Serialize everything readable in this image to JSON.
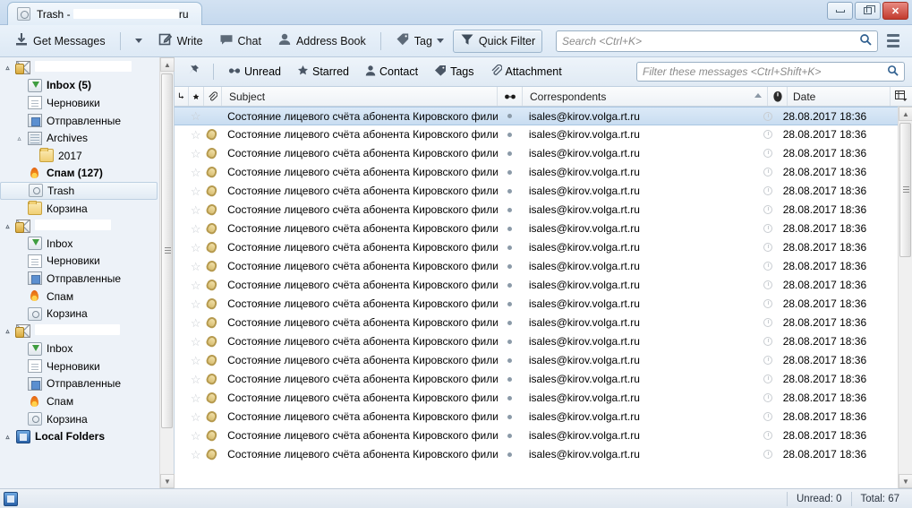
{
  "window": {
    "tab_title_prefix": "Trash - ",
    "tab_title_suffix": "ru",
    "tab_icon": "trash-icon",
    "minimize_label": "",
    "maximize_label": "",
    "close_label": "✕"
  },
  "toolbar": {
    "get_messages": "Get Messages",
    "write": "Write",
    "chat": "Chat",
    "address_book": "Address Book",
    "tag": "Tag",
    "quick_filter": "Quick Filter",
    "search_placeholder": "Search <Ctrl+K>"
  },
  "quick_filter_bar": {
    "unread": "Unread",
    "starred": "Starred",
    "contact": "Contact",
    "tags": "Tags",
    "attachment": "Attachment",
    "filter_placeholder": "Filter these messages <Ctrl+Shift+K>"
  },
  "columns": {
    "subject": "Subject",
    "correspondents": "Correspondents",
    "date": "Date"
  },
  "sidebar": {
    "items": [
      {
        "label": "",
        "redacted": true,
        "redact_width": 108,
        "icon": "account-icon",
        "indent": 0,
        "twisty": "▵",
        "bold": true,
        "selected": false
      },
      {
        "label": "Inbox (5)",
        "icon": "inbox-icon",
        "indent": 1,
        "twisty": "",
        "bold": true,
        "selected": false
      },
      {
        "label": "Черновики",
        "icon": "draft-icon",
        "indent": 1,
        "twisty": "",
        "bold": false,
        "selected": false
      },
      {
        "label": "Отправленные",
        "icon": "sent-icon",
        "indent": 1,
        "twisty": "",
        "bold": false,
        "selected": false
      },
      {
        "label": "Archives",
        "icon": "archive-icon",
        "indent": 1,
        "twisty": "▵",
        "bold": false,
        "selected": false
      },
      {
        "label": "2017",
        "icon": "folder-icon",
        "indent": 2,
        "twisty": "",
        "bold": false,
        "selected": false
      },
      {
        "label": "Спам (127)",
        "icon": "spam-icon",
        "indent": 1,
        "twisty": "",
        "bold": true,
        "selected": false
      },
      {
        "label": "Trash",
        "icon": "trash-icon",
        "indent": 1,
        "twisty": "",
        "bold": false,
        "selected": true
      },
      {
        "label": "Корзина",
        "icon": "folder-icon",
        "indent": 1,
        "twisty": "",
        "bold": false,
        "selected": false
      },
      {
        "label": "",
        "redacted": true,
        "redact_width": 85,
        "icon": "account-icon",
        "indent": 0,
        "twisty": "▵",
        "bold": true,
        "selected": false
      },
      {
        "label": "Inbox",
        "icon": "inbox-icon",
        "indent": 1,
        "twisty": "",
        "bold": false,
        "selected": false
      },
      {
        "label": "Черновики",
        "icon": "draft-icon",
        "indent": 1,
        "twisty": "",
        "bold": false,
        "selected": false
      },
      {
        "label": "Отправленные",
        "icon": "sent-icon",
        "indent": 1,
        "twisty": "",
        "bold": false,
        "selected": false
      },
      {
        "label": "Спам",
        "icon": "spam-icon",
        "indent": 1,
        "twisty": "",
        "bold": false,
        "selected": false
      },
      {
        "label": "Корзина",
        "icon": "trash-icon",
        "indent": 1,
        "twisty": "",
        "bold": false,
        "selected": false
      },
      {
        "label": "",
        "redacted": true,
        "redact_width": 95,
        "icon": "account-icon",
        "indent": 0,
        "twisty": "▵",
        "bold": true,
        "selected": false
      },
      {
        "label": "Inbox",
        "icon": "inbox-icon",
        "indent": 1,
        "twisty": "",
        "bold": false,
        "selected": false
      },
      {
        "label": "Черновики",
        "icon": "draft-icon",
        "indent": 1,
        "twisty": "",
        "bold": false,
        "selected": false
      },
      {
        "label": "Отправленные",
        "icon": "sent-icon",
        "indent": 1,
        "twisty": "",
        "bold": false,
        "selected": false
      },
      {
        "label": "Спам",
        "icon": "spam-icon",
        "indent": 1,
        "twisty": "",
        "bold": false,
        "selected": false
      },
      {
        "label": "Корзина",
        "icon": "trash-icon",
        "indent": 1,
        "twisty": "",
        "bold": false,
        "selected": false
      },
      {
        "label": "Local Folders",
        "icon": "local-folders-icon",
        "indent": 0,
        "twisty": "▵",
        "bold": true,
        "selected": false
      }
    ]
  },
  "messages": {
    "rows": [
      {
        "subject": "Состояние лицевого счёта абонента Кировского фили...",
        "correspondent": "isales@kirov.volga.rt.ru",
        "date": "28.08.2017 18:36",
        "attachment": false,
        "selected": true
      },
      {
        "subject": "Состояние лицевого счёта абонента Кировского фили...",
        "correspondent": "isales@kirov.volga.rt.ru",
        "date": "28.08.2017 18:36",
        "attachment": true,
        "selected": false
      },
      {
        "subject": "Состояние лицевого счёта абонента Кировского фили...",
        "correspondent": "isales@kirov.volga.rt.ru",
        "date": "28.08.2017 18:36",
        "attachment": true,
        "selected": false
      },
      {
        "subject": "Состояние лицевого счёта абонента Кировского фили...",
        "correspondent": "isales@kirov.volga.rt.ru",
        "date": "28.08.2017 18:36",
        "attachment": true,
        "selected": false
      },
      {
        "subject": "Состояние лицевого счёта абонента Кировского фили...",
        "correspondent": "isales@kirov.volga.rt.ru",
        "date": "28.08.2017 18:36",
        "attachment": true,
        "selected": false
      },
      {
        "subject": "Состояние лицевого счёта абонента Кировского фили...",
        "correspondent": "isales@kirov.volga.rt.ru",
        "date": "28.08.2017 18:36",
        "attachment": true,
        "selected": false
      },
      {
        "subject": "Состояние лицевого счёта абонента Кировского фили...",
        "correspondent": "isales@kirov.volga.rt.ru",
        "date": "28.08.2017 18:36",
        "attachment": true,
        "selected": false
      },
      {
        "subject": "Состояние лицевого счёта абонента Кировского фили...",
        "correspondent": "isales@kirov.volga.rt.ru",
        "date": "28.08.2017 18:36",
        "attachment": true,
        "selected": false
      },
      {
        "subject": "Состояние лицевого счёта абонента Кировского фили...",
        "correspondent": "isales@kirov.volga.rt.ru",
        "date": "28.08.2017 18:36",
        "attachment": true,
        "selected": false
      },
      {
        "subject": "Состояние лицевого счёта абонента Кировского фили...",
        "correspondent": "isales@kirov.volga.rt.ru",
        "date": "28.08.2017 18:36",
        "attachment": true,
        "selected": false
      },
      {
        "subject": "Состояние лицевого счёта абонента Кировского фили...",
        "correspondent": "isales@kirov.volga.rt.ru",
        "date": "28.08.2017 18:36",
        "attachment": true,
        "selected": false
      },
      {
        "subject": "Состояние лицевого счёта абонента Кировского фили...",
        "correspondent": "isales@kirov.volga.rt.ru",
        "date": "28.08.2017 18:36",
        "attachment": true,
        "selected": false
      },
      {
        "subject": "Состояние лицевого счёта абонента Кировского фили...",
        "correspondent": "isales@kirov.volga.rt.ru",
        "date": "28.08.2017 18:36",
        "attachment": true,
        "selected": false
      },
      {
        "subject": "Состояние лицевого счёта абонента Кировского фили...",
        "correspondent": "isales@kirov.volga.rt.ru",
        "date": "28.08.2017 18:36",
        "attachment": true,
        "selected": false
      },
      {
        "subject": "Состояние лицевого счёта абонента Кировского фили...",
        "correspondent": "isales@kirov.volga.rt.ru",
        "date": "28.08.2017 18:36",
        "attachment": true,
        "selected": false
      },
      {
        "subject": "Состояние лицевого счёта абонента Кировского фили...",
        "correspondent": "isales@kirov.volga.rt.ru",
        "date": "28.08.2017 18:36",
        "attachment": true,
        "selected": false
      },
      {
        "subject": "Состояние лицевого счёта абонента Кировского фили...",
        "correspondent": "isales@kirov.volga.rt.ru",
        "date": "28.08.2017 18:36",
        "attachment": true,
        "selected": false
      },
      {
        "subject": "Состояние лицевого счёта абонента Кировского фили...",
        "correspondent": "isales@kirov.volga.rt.ru",
        "date": "28.08.2017 18:36",
        "attachment": true,
        "selected": false
      },
      {
        "subject": "Состояние лицевого счёта абонента Кировского фили...",
        "correspondent": "isales@kirov.volga.rt.ru",
        "date": "28.08.2017 18:36",
        "attachment": true,
        "selected": false
      }
    ]
  },
  "statusbar": {
    "unread": "Unread: 0",
    "total": "Total: 67"
  }
}
